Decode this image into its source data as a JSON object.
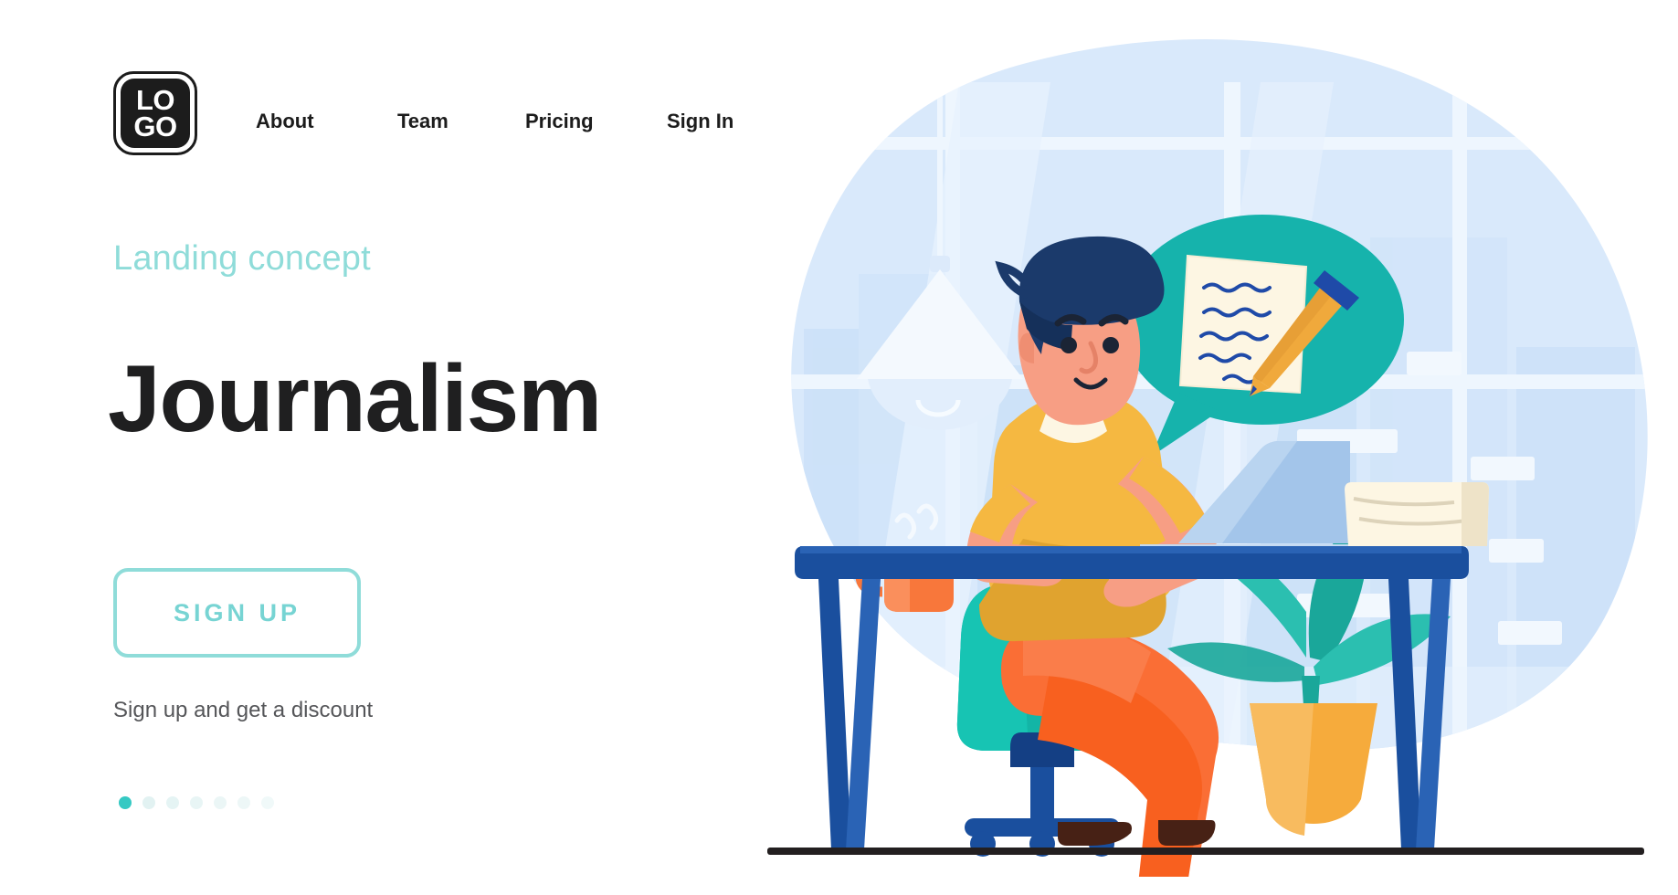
{
  "brand": {
    "logo_line1": "LO",
    "logo_line2": "GO"
  },
  "nav": {
    "items": [
      {
        "label": "About",
        "name": "nav-item-about"
      },
      {
        "label": "Team",
        "name": "nav-item-team"
      },
      {
        "label": "Pricing",
        "name": "nav-item-pricing"
      },
      {
        "label": "Sign In",
        "name": "nav-item-sign-in"
      }
    ],
    "menu_icon": "ellipsis-horizontal-icon"
  },
  "hero": {
    "eyebrow": "Landing concept",
    "headline": "Journalism",
    "cta_label": "SIGN UP",
    "subtext": "Sign up and get a discount"
  },
  "pagination": {
    "total": 7,
    "active_index": 0,
    "active_color": "#35c9c3",
    "inactive_color": "#dff1f1"
  },
  "colors": {
    "accent_teal": "#8fdcd9",
    "bubble_teal": "#16b3ac",
    "text_dark": "#1f1f20",
    "subtext_gray": "#555659",
    "blob_blue": "#d6e8fb",
    "desk_blue": "#1a4f9e",
    "shirt_yellow": "#f5b841",
    "pants_orange": "#fa6e35",
    "skin": "#f79e84",
    "hair_navy": "#1b3a6b",
    "chair_teal": "#13b5a6",
    "pot_amber": "#f6ab3c",
    "paper_cream": "#fdf6e3",
    "pen_orange": "#f0a93c"
  },
  "illustration": {
    "scene_name": "journalist-at-desk-illustration",
    "elements": [
      "background-blob",
      "window-frame",
      "city-skyline",
      "pendant-lamp",
      "speech-bubble",
      "document-page",
      "pen",
      "person",
      "laptop",
      "coffee-mug",
      "paper-stack",
      "desk",
      "office-chair",
      "potted-plant",
      "floor-line"
    ]
  }
}
